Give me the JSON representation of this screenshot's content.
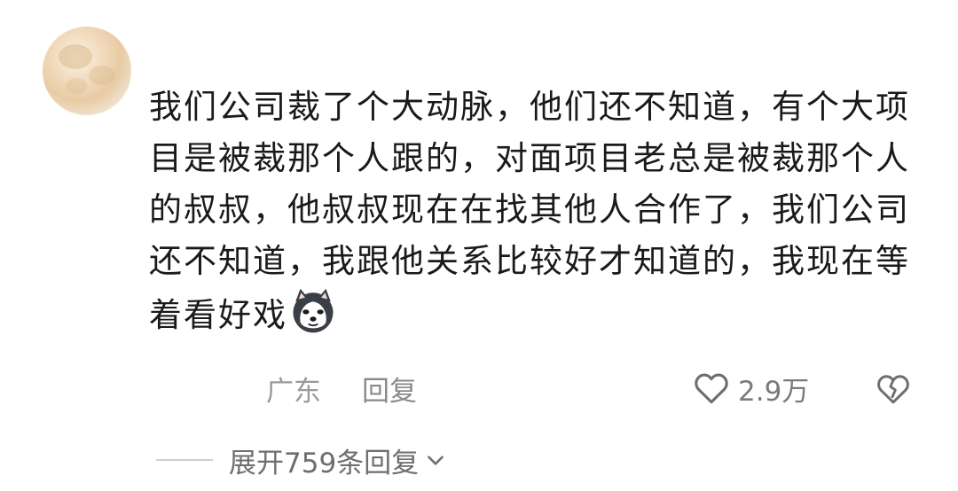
{
  "comment": {
    "text": "我们公司裁了个大动脉，他们还不知道，有个大项目是被裁那个人跟的，对面项目老总是被裁那个人的叔叔，他叔叔现在在找其他人合作了，我们公司还不知道，我跟他关系比较好才知道的，我现在等着看好戏",
    "emoji": "husky-dog-emoji",
    "location": "广东",
    "reply_label": "回复",
    "like_count": "2.9万"
  },
  "replies": {
    "expand_label": "展开759条回复"
  },
  "icons": {
    "avatar": "avatar",
    "like": "heart-icon",
    "dislike": "broken-heart-icon",
    "expand": "chevron-down-icon"
  },
  "colors": {
    "text": "#1a1a1a",
    "meta": "#9a9a9a",
    "icon": "#6e6e6e"
  }
}
